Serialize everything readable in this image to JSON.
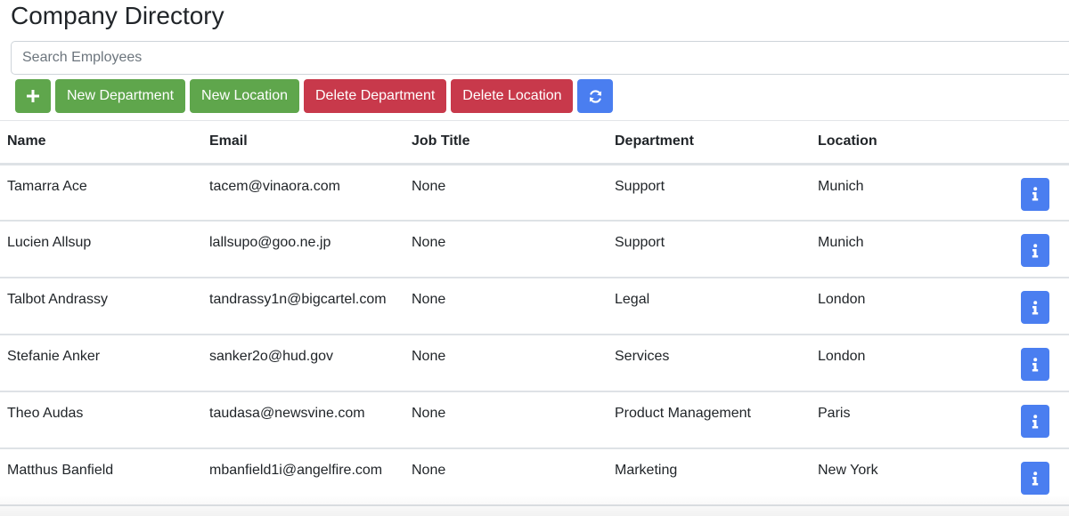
{
  "page": {
    "title": "Company Directory"
  },
  "search": {
    "placeholder": "Search Employees",
    "value": ""
  },
  "toolbar": {
    "add_icon": "plus-icon",
    "new_department_label": "New Department",
    "new_location_label": "New Location",
    "delete_department_label": "Delete Department",
    "delete_location_label": "Delete Location",
    "refresh_icon": "refresh-icon"
  },
  "colors": {
    "green": "#5fa64c",
    "red": "#c8394b",
    "blue": "#4a7ef0"
  },
  "table": {
    "headers": [
      "Name",
      "Email",
      "Job Title",
      "Department",
      "Location"
    ],
    "rows": [
      {
        "name": "Tamarra Ace",
        "email": "tacem@vinaora.com",
        "job_title": "None",
        "department": "Support",
        "location": "Munich"
      },
      {
        "name": "Lucien Allsup",
        "email": "lallsupo@goo.ne.jp",
        "job_title": "None",
        "department": "Support",
        "location": "Munich"
      },
      {
        "name": "Talbot Andrassy",
        "email": "tandrassy1n@bigcartel.com",
        "job_title": "None",
        "department": "Legal",
        "location": "London"
      },
      {
        "name": "Stefanie Anker",
        "email": "sanker2o@hud.gov",
        "job_title": "None",
        "department": "Services",
        "location": "London"
      },
      {
        "name": "Theo Audas",
        "email": "taudasa@newsvine.com",
        "job_title": "None",
        "department": "Product Management",
        "location": "Paris"
      },
      {
        "name": "Matthus Banfield",
        "email": "mbanfield1i@angelfire.com",
        "job_title": "None",
        "department": "Marketing",
        "location": "New York"
      }
    ],
    "row_action_icon": "info-icon"
  }
}
